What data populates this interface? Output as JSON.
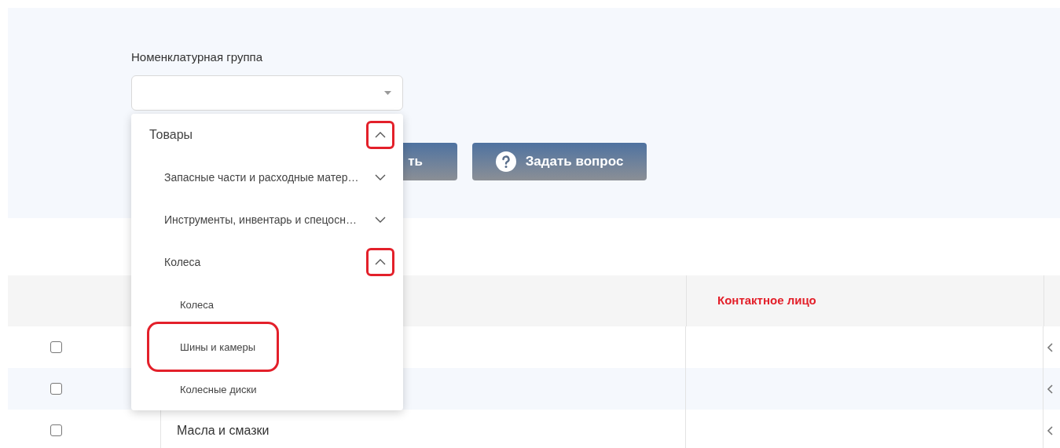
{
  "filter": {
    "label": "Номенклатурная группа"
  },
  "buttons": [
    {
      "kind": "plain",
      "label": "ть"
    },
    {
      "kind": "help",
      "label": "Задать вопрос"
    }
  ],
  "dropdown": {
    "items": [
      {
        "label": "Товары",
        "expanded": true,
        "highlighted": true,
        "children": [
          {
            "label": "Запасные части и расходные матер…",
            "expanded": false,
            "highlighted": false
          },
          {
            "label": "Инструменты, инвентарь и спецосн…",
            "expanded": false,
            "highlighted": false
          },
          {
            "label": "Колеса",
            "expanded": true,
            "highlighted": true,
            "children": [
              {
                "label": "Колеса",
                "highlighted": false
              },
              {
                "label": "Шины и камеры",
                "highlighted": true
              },
              {
                "label": "Колесные диски",
                "highlighted": false
              }
            ]
          }
        ]
      }
    ]
  },
  "table": {
    "columns": [
      {
        "label": "Контактное лицо"
      }
    ],
    "rows": [
      {
        "checked": false
      },
      {
        "checked": false
      },
      {
        "checked": false,
        "name": "Масла и смазки"
      }
    ]
  }
}
